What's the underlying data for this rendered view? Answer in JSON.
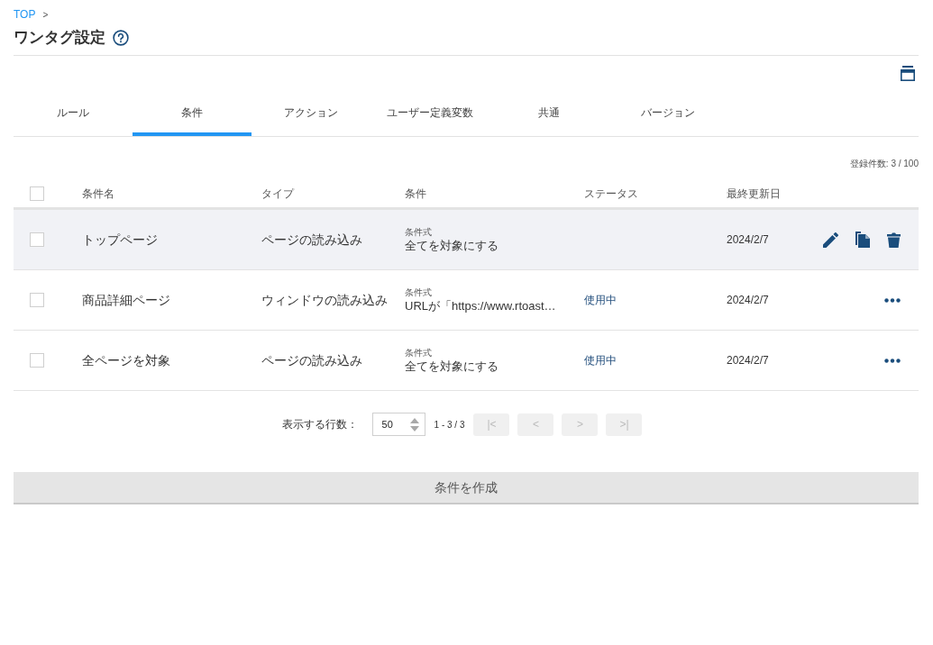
{
  "breadcrumb": [
    {
      "label": "TOP",
      "separator": ">"
    }
  ],
  "page": {
    "title": "ワンタグ設定"
  },
  "tabs": [
    {
      "label": "ルール",
      "selected": false
    },
    {
      "label": "条件",
      "selected": true
    },
    {
      "label": "アクション",
      "selected": false
    },
    {
      "label": "ユーザー定義変数",
      "selected": false
    },
    {
      "label": "共通",
      "selected": false
    },
    {
      "label": "バージョン",
      "selected": false
    }
  ],
  "table": {
    "count": "登録件数: 3 / 100",
    "select_all": {
      "checked": false
    },
    "columns": [
      "条件名",
      "タイプ",
      "条件",
      "ステータス",
      "最終更新日"
    ],
    "rows": [
      {
        "checked": false,
        "hovered": true,
        "name": "トップページ",
        "type": "ページの読み込み",
        "condition_label": "条件式",
        "condition": "全てを対象にする",
        "updated": "2024/2/7"
      },
      {
        "checked": false,
        "hovered": false,
        "name": "商品詳細ページ",
        "type": "ウィンドウの読み込み",
        "condition_label": "条件式",
        "condition": "URLが「https://www.rtoast…",
        "status": "使用中",
        "updated": "2024/2/7"
      },
      {
        "checked": false,
        "hovered": false,
        "name": "全ページを対象",
        "type": "ページの読み込み",
        "condition_label": "条件式",
        "condition": "全てを対象にする",
        "status": "使用中",
        "updated": "2024/2/7"
      }
    ]
  },
  "pagination": {
    "label": "表示する行数：",
    "rows_per_page": "50",
    "range": "1 - 3 / 3",
    "buttons": [
      {
        "label": "|<",
        "disabled": true
      },
      {
        "label": "<",
        "disabled": true
      },
      {
        "label": ">",
        "disabled": true
      },
      {
        "label": ">|",
        "disabled": true
      }
    ]
  },
  "create_button": {
    "label": "条件を作成"
  }
}
